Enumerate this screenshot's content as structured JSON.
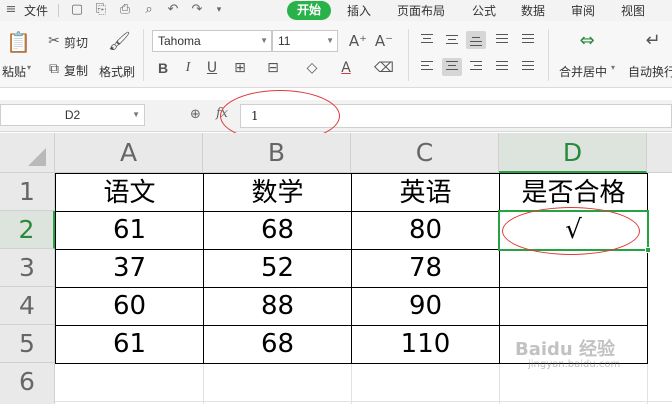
{
  "menu": {
    "file": "文件",
    "tabs": [
      "开始",
      "插入",
      "页面布局",
      "公式",
      "数据",
      "审阅",
      "视图"
    ]
  },
  "ribbon": {
    "paste": "粘贴",
    "cut": "剪切",
    "copy": "复制",
    "format_painter": "格式刷",
    "font_name": "Tahoma",
    "font_size": "11",
    "merge_center": "合并居中",
    "wrap_text": "自动换行"
  },
  "formula_bar": {
    "name_box": "D2",
    "fx_label": "fx",
    "formula": "1"
  },
  "grid": {
    "columns": [
      "A",
      "B",
      "C",
      "D"
    ],
    "rows": [
      "1",
      "2",
      "3",
      "4",
      "5",
      "6"
    ],
    "header_row": [
      "语文",
      "数学",
      "英语",
      "是否合格"
    ],
    "data": [
      [
        "61",
        "68",
        "80",
        "√"
      ],
      [
        "37",
        "52",
        "78",
        ""
      ],
      [
        "60",
        "88",
        "90",
        ""
      ],
      [
        "61",
        "68",
        "110",
        ""
      ]
    ],
    "selected_cell": "D2"
  },
  "watermark": {
    "logo": "Baidu 经验",
    "url": "jingyan.baidu.com"
  },
  "colors": {
    "accent": "#27a243",
    "annotation": "#e03a3a"
  }
}
